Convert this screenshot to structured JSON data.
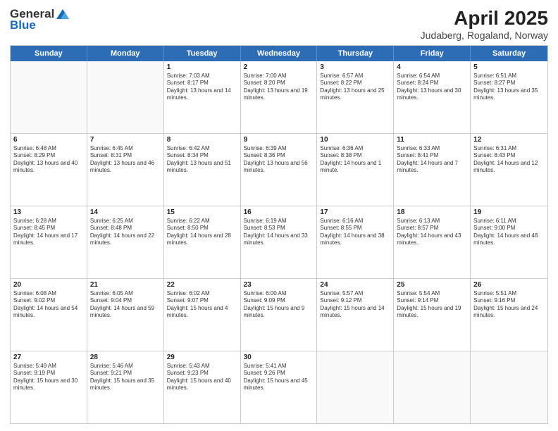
{
  "header": {
    "logo_general": "General",
    "logo_blue": "Blue",
    "title": "April 2025",
    "subtitle": "Judaberg, Rogaland, Norway"
  },
  "days_of_week": [
    "Sunday",
    "Monday",
    "Tuesday",
    "Wednesday",
    "Thursday",
    "Friday",
    "Saturday"
  ],
  "weeks": [
    [
      {
        "day": "",
        "sunrise": "",
        "sunset": "",
        "daylight": ""
      },
      {
        "day": "",
        "sunrise": "",
        "sunset": "",
        "daylight": ""
      },
      {
        "day": "1",
        "sunrise": "Sunrise: 7:03 AM",
        "sunset": "Sunset: 8:17 PM",
        "daylight": "Daylight: 13 hours and 14 minutes."
      },
      {
        "day": "2",
        "sunrise": "Sunrise: 7:00 AM",
        "sunset": "Sunset: 8:20 PM",
        "daylight": "Daylight: 13 hours and 19 minutes."
      },
      {
        "day": "3",
        "sunrise": "Sunrise: 6:57 AM",
        "sunset": "Sunset: 8:22 PM",
        "daylight": "Daylight: 13 hours and 25 minutes."
      },
      {
        "day": "4",
        "sunrise": "Sunrise: 6:54 AM",
        "sunset": "Sunset: 8:24 PM",
        "daylight": "Daylight: 13 hours and 30 minutes."
      },
      {
        "day": "5",
        "sunrise": "Sunrise: 6:51 AM",
        "sunset": "Sunset: 8:27 PM",
        "daylight": "Daylight: 13 hours and 35 minutes."
      }
    ],
    [
      {
        "day": "6",
        "sunrise": "Sunrise: 6:48 AM",
        "sunset": "Sunset: 8:29 PM",
        "daylight": "Daylight: 13 hours and 40 minutes."
      },
      {
        "day": "7",
        "sunrise": "Sunrise: 6:45 AM",
        "sunset": "Sunset: 8:31 PM",
        "daylight": "Daylight: 13 hours and 46 minutes."
      },
      {
        "day": "8",
        "sunrise": "Sunrise: 6:42 AM",
        "sunset": "Sunset: 8:34 PM",
        "daylight": "Daylight: 13 hours and 51 minutes."
      },
      {
        "day": "9",
        "sunrise": "Sunrise: 6:39 AM",
        "sunset": "Sunset: 8:36 PM",
        "daylight": "Daylight: 13 hours and 56 minutes."
      },
      {
        "day": "10",
        "sunrise": "Sunrise: 6:36 AM",
        "sunset": "Sunset: 8:38 PM",
        "daylight": "Daylight: 14 hours and 1 minute."
      },
      {
        "day": "11",
        "sunrise": "Sunrise: 6:33 AM",
        "sunset": "Sunset: 8:41 PM",
        "daylight": "Daylight: 14 hours and 7 minutes."
      },
      {
        "day": "12",
        "sunrise": "Sunrise: 6:31 AM",
        "sunset": "Sunset: 8:43 PM",
        "daylight": "Daylight: 14 hours and 12 minutes."
      }
    ],
    [
      {
        "day": "13",
        "sunrise": "Sunrise: 6:28 AM",
        "sunset": "Sunset: 8:45 PM",
        "daylight": "Daylight: 14 hours and 17 minutes."
      },
      {
        "day": "14",
        "sunrise": "Sunrise: 6:25 AM",
        "sunset": "Sunset: 8:48 PM",
        "daylight": "Daylight: 14 hours and 22 minutes."
      },
      {
        "day": "15",
        "sunrise": "Sunrise: 6:22 AM",
        "sunset": "Sunset: 8:50 PM",
        "daylight": "Daylight: 14 hours and 28 minutes."
      },
      {
        "day": "16",
        "sunrise": "Sunrise: 6:19 AM",
        "sunset": "Sunset: 8:53 PM",
        "daylight": "Daylight: 14 hours and 33 minutes."
      },
      {
        "day": "17",
        "sunrise": "Sunrise: 6:16 AM",
        "sunset": "Sunset: 8:55 PM",
        "daylight": "Daylight: 14 hours and 38 minutes."
      },
      {
        "day": "18",
        "sunrise": "Sunrise: 6:13 AM",
        "sunset": "Sunset: 8:57 PM",
        "daylight": "Daylight: 14 hours and 43 minutes."
      },
      {
        "day": "19",
        "sunrise": "Sunrise: 6:11 AM",
        "sunset": "Sunset: 9:00 PM",
        "daylight": "Daylight: 14 hours and 48 minutes."
      }
    ],
    [
      {
        "day": "20",
        "sunrise": "Sunrise: 6:08 AM",
        "sunset": "Sunset: 9:02 PM",
        "daylight": "Daylight: 14 hours and 54 minutes."
      },
      {
        "day": "21",
        "sunrise": "Sunrise: 6:05 AM",
        "sunset": "Sunset: 9:04 PM",
        "daylight": "Daylight: 14 hours and 59 minutes."
      },
      {
        "day": "22",
        "sunrise": "Sunrise: 6:02 AM",
        "sunset": "Sunset: 9:07 PM",
        "daylight": "Daylight: 15 hours and 4 minutes."
      },
      {
        "day": "23",
        "sunrise": "Sunrise: 6:00 AM",
        "sunset": "Sunset: 9:09 PM",
        "daylight": "Daylight: 15 hours and 9 minutes."
      },
      {
        "day": "24",
        "sunrise": "Sunrise: 5:57 AM",
        "sunset": "Sunset: 9:12 PM",
        "daylight": "Daylight: 15 hours and 14 minutes."
      },
      {
        "day": "25",
        "sunrise": "Sunrise: 5:54 AM",
        "sunset": "Sunset: 9:14 PM",
        "daylight": "Daylight: 15 hours and 19 minutes."
      },
      {
        "day": "26",
        "sunrise": "Sunrise: 5:51 AM",
        "sunset": "Sunset: 9:16 PM",
        "daylight": "Daylight: 15 hours and 24 minutes."
      }
    ],
    [
      {
        "day": "27",
        "sunrise": "Sunrise: 5:49 AM",
        "sunset": "Sunset: 9:19 PM",
        "daylight": "Daylight: 15 hours and 30 minutes."
      },
      {
        "day": "28",
        "sunrise": "Sunrise: 5:46 AM",
        "sunset": "Sunset: 9:21 PM",
        "daylight": "Daylight: 15 hours and 35 minutes."
      },
      {
        "day": "29",
        "sunrise": "Sunrise: 5:43 AM",
        "sunset": "Sunset: 9:23 PM",
        "daylight": "Daylight: 15 hours and 40 minutes."
      },
      {
        "day": "30",
        "sunrise": "Sunrise: 5:41 AM",
        "sunset": "Sunset: 9:26 PM",
        "daylight": "Daylight: 15 hours and 45 minutes."
      },
      {
        "day": "",
        "sunrise": "",
        "sunset": "",
        "daylight": ""
      },
      {
        "day": "",
        "sunrise": "",
        "sunset": "",
        "daylight": ""
      },
      {
        "day": "",
        "sunrise": "",
        "sunset": "",
        "daylight": ""
      }
    ]
  ]
}
